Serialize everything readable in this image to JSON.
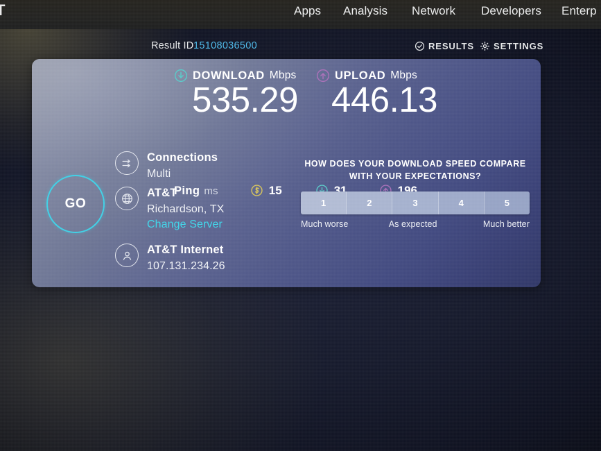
{
  "nav": {
    "logo": "T",
    "items": [
      {
        "label": "Apps",
        "id": "apps"
      },
      {
        "label": "Analysis",
        "id": "analysis"
      },
      {
        "label": "Network",
        "id": "network"
      },
      {
        "label": "Developers",
        "id": "developers"
      },
      {
        "label": "Enterp",
        "id": "enterprise"
      }
    ]
  },
  "result_bar": {
    "result_id_label": "Result ID",
    "result_id_value": "15108036500",
    "result_id_color": "#4db8e8",
    "results_tab": "RESULTS",
    "settings_tab": "SETTINGS"
  },
  "card": {
    "download": {
      "label": "DOWNLOAD",
      "unit": "Mbps",
      "value": "535.29",
      "icon": "arrow-down-circle-icon",
      "color": "#59c9c8"
    },
    "upload": {
      "label": "UPLOAD",
      "unit": "Mbps",
      "value": "446.13",
      "icon": "arrow-up-circle-icon",
      "color": "#a86fb8"
    },
    "ping": {
      "label": "Ping",
      "unit": "ms",
      "idle": {
        "value": "15",
        "icon": "latency-idle-icon",
        "color": "#d6c35a"
      },
      "download": {
        "value": "31",
        "icon": "latency-download-icon",
        "color": "#59c9c8"
      },
      "upload": {
        "value": "196",
        "icon": "latency-upload-icon",
        "color": "#a86fb8"
      }
    },
    "go_button": {
      "label": "GO",
      "color": "#3fd0e6"
    },
    "info": {
      "connections": {
        "title": "Connections",
        "value": "Multi",
        "icon": "connections-icon"
      },
      "isp": {
        "title": "AT&T",
        "value": "Richardson, TX",
        "link": "Change Server",
        "icon": "globe-icon",
        "link_color": "#3fd6ea"
      },
      "account": {
        "title": "AT&T Internet",
        "value": "107.131.234.26",
        "icon": "user-icon"
      }
    },
    "rating": {
      "question_line1": "HOW DOES YOUR DOWNLOAD SPEED COMPARE",
      "question_line2": "WITH YOUR EXPECTATIONS?",
      "options": [
        "1",
        "2",
        "3",
        "4",
        "5"
      ],
      "legend_low": "Much worse",
      "legend_mid": "As expected",
      "legend_high": "Much better"
    }
  }
}
